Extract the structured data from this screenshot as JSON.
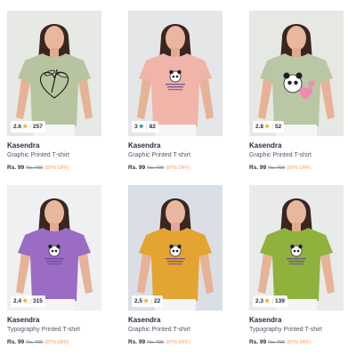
{
  "products": [
    {
      "brand": "Kasendra",
      "title": "Graphic Printed T-shirt",
      "rating": "2.6",
      "star_color": "#f5a623",
      "reviews": "257",
      "price": "Rs. 99",
      "mrp": "Rs. 799",
      "discount": "(87% OFF)",
      "shirt_color": "#b7c4a0",
      "bg_color": "#e6e9e4",
      "graphic": "heart-dragonfly"
    },
    {
      "brand": "Kasendra",
      "title": "Graphic Printed T-shirt",
      "rating": "3",
      "star_color": "#14958f",
      "reviews": "82",
      "price": "Rs. 99",
      "mrp": "Rs. 799",
      "discount": "(87% OFF)",
      "shirt_color": "#f0b4a8",
      "bg_color": "#e4e6e7",
      "graphic": "panda-text"
    },
    {
      "brand": "Kasendra",
      "title": "Graphic Printed T-shirt",
      "rating": "2.8",
      "star_color": "#f5a623",
      "reviews": "52",
      "price": "Rs. 99",
      "mrp": "Rs. 799",
      "discount": "(87% OFF)",
      "shirt_color": "#b9c7a4",
      "bg_color": "#e6e8e3",
      "graphic": "panda-heart"
    },
    {
      "brand": "Kasendra",
      "title": "Typography Printed T-shirt",
      "rating": "2.4",
      "star_color": "#f5a623",
      "reviews": "315",
      "price": "Rs. 99",
      "mrp": "Rs. 799",
      "discount": "(87% OFF)",
      "shirt_color": "#9b6cc4",
      "bg_color": "#eef0f1",
      "graphic": "panda-text"
    },
    {
      "brand": "Kasendra",
      "title": "Graphic Printed T-shirt",
      "rating": "2.5",
      "star_color": "#f5a623",
      "reviews": "22",
      "price": "Rs. 99",
      "mrp": "Rs. 799",
      "discount": "(87% OFF)",
      "shirt_color": "#e3a431",
      "bg_color": "#d9dfe4",
      "graphic": "panda-text"
    },
    {
      "brand": "Kasendra",
      "title": "Typography Printed T-shirt",
      "rating": "2.3",
      "star_color": "#f5a623",
      "reviews": "139",
      "price": "Rs. 99",
      "mrp": "Rs. 799",
      "discount": "(87% OFF)",
      "shirt_color": "#8fb23c",
      "bg_color": "#e9eaea",
      "graphic": "panda-text"
    }
  ]
}
